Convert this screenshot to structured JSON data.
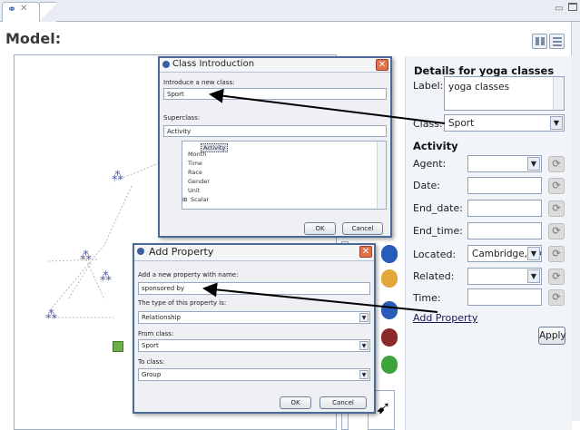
{
  "editor": {
    "title": "Model:"
  },
  "details": {
    "heading": "Details for yoga classes",
    "label_label": "Label:",
    "label_value": "yoga classes",
    "class_label": "Class:",
    "class_value": "Sport",
    "section": "Activity",
    "fields": [
      {
        "label": "Agent:",
        "value": "",
        "type": "select"
      },
      {
        "label": "Date:",
        "value": "",
        "type": "text"
      },
      {
        "label": "End_date:",
        "value": "",
        "type": "text"
      },
      {
        "label": "End_time:",
        "value": "",
        "type": "text"
      },
      {
        "label": "Located:",
        "value": "Cambridge, MA",
        "type": "select"
      },
      {
        "label": "Related:",
        "value": "",
        "type": "select"
      },
      {
        "label": "Time:",
        "value": "",
        "type": "text"
      }
    ],
    "add_property_link": "Add Property",
    "apply_label": "Apply"
  },
  "class_dialog": {
    "title": "Class Introduction",
    "intro_label": "Introduce a new class:",
    "intro_value": "Sport",
    "superclass_label": "Superclass:",
    "superclass_value": "Activity",
    "tree": [
      "Activity",
      "Month",
      "Time",
      "Race",
      "Gender",
      "Unit",
      "Scalar"
    ],
    "ok_label": "OK",
    "cancel_label": "Cancel"
  },
  "property_dialog": {
    "title": "Add Property",
    "name_label": "Add a new property with name:",
    "name_value": "sponsored by",
    "type_label": "The type of this property is:",
    "type_value": "Relationship",
    "from_label": "From class:",
    "from_value": "Sport",
    "to_label": "To class:",
    "to_value": "Group",
    "ok_label": "OK",
    "cancel_label": "Cancel"
  },
  "colors": {
    "accent": "#4c6a99",
    "panel": "#f1f4f8",
    "close": "#e0724a"
  }
}
